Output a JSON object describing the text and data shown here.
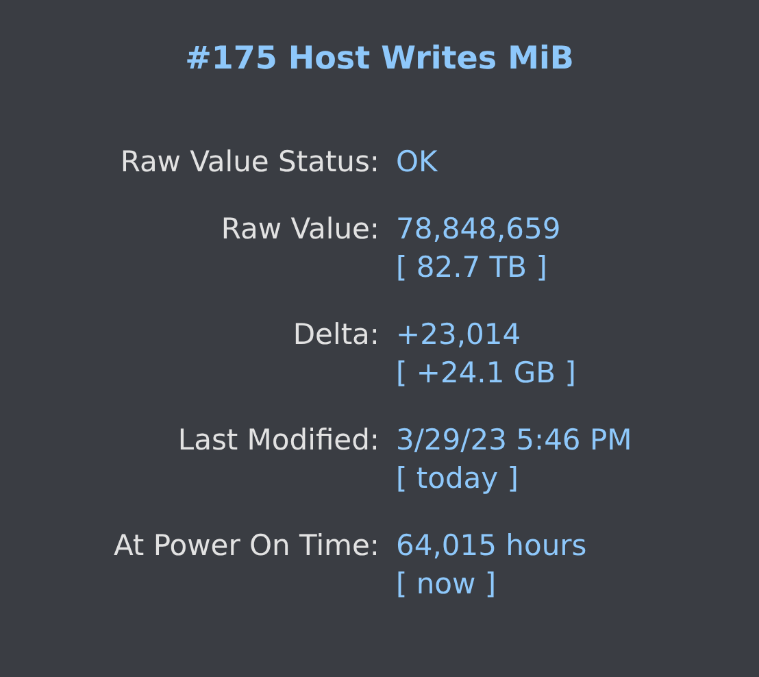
{
  "popover": {
    "title": "#175 Host Writes MiB",
    "rows": [
      {
        "label": "Raw Value Status:",
        "value": "OK"
      },
      {
        "label": "Raw Value:",
        "value": "78,848,659",
        "note": "[ 82.7 TB ]"
      },
      {
        "label": "Delta:",
        "value": "+23,014",
        "note": "[ +24.1 GB ]"
      },
      {
        "label": "Last Modified:",
        "value": "3/29/23 5:46 PM",
        "note": "[ today ]"
      },
      {
        "label": "At Power On Time:",
        "value": "64,015 hours",
        "note": "[ now ]"
      }
    ]
  }
}
